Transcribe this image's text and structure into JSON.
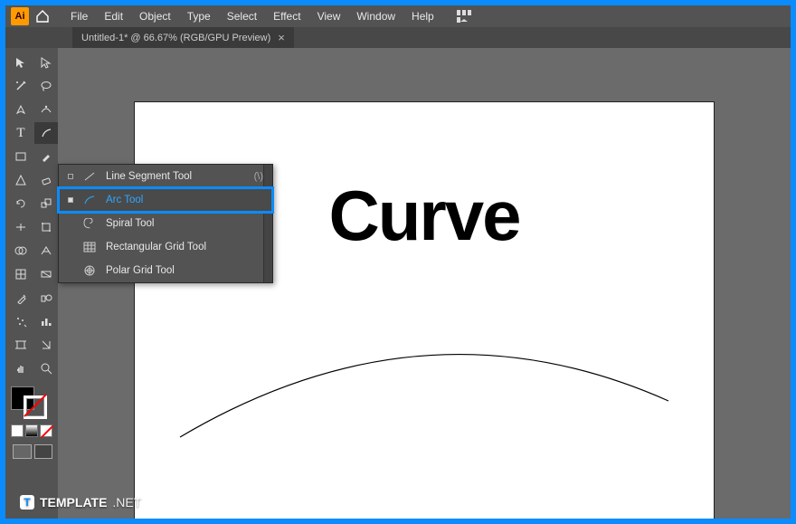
{
  "titlebar": {
    "app_abbrev": "Ai",
    "menus": [
      "File",
      "Edit",
      "Object",
      "Type",
      "Select",
      "Effect",
      "View",
      "Window",
      "Help"
    ]
  },
  "tab": {
    "title": "Untitled-1* @ 66.67% (RGB/GPU Preview)",
    "close": "×"
  },
  "flyout": {
    "items": [
      {
        "label": "Line Segment Tool",
        "shortcut": "(\\)",
        "selected": false
      },
      {
        "label": "Arc Tool",
        "shortcut": "",
        "selected": true
      },
      {
        "label": "Spiral Tool",
        "shortcut": "",
        "selected": false
      },
      {
        "label": "Rectangular Grid Tool",
        "shortcut": "",
        "selected": false
      },
      {
        "label": "Polar Grid Tool",
        "shortcut": "",
        "selected": false
      }
    ]
  },
  "canvas": {
    "headline": "Curve"
  },
  "watermark": {
    "icon": "T",
    "brand": "TEMPLATE",
    "suffix": ".NET"
  }
}
